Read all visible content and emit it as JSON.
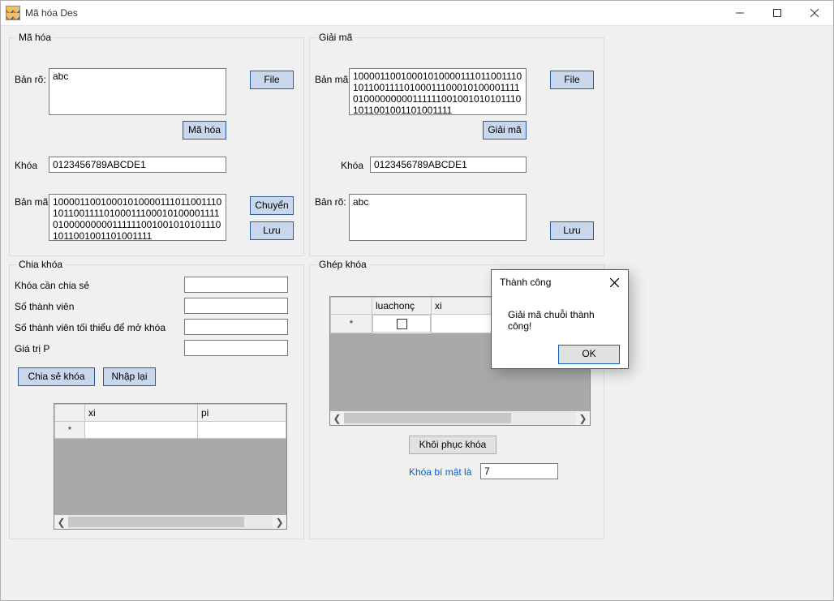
{
  "window": {
    "title": "Mã hóa Des"
  },
  "encrypt": {
    "legend": "Mã hóa",
    "plaintext_label": "Bản rõ:",
    "plaintext_value": "abc",
    "file_label": "File",
    "encrypt_btn": "Mã hóa",
    "key_label": "Khóa",
    "key_value": "0123456789ABCDE1",
    "ciphertext_label": "Bản mã:",
    "ciphertext_value": "1000011001000101000011101100111010110011110100011100010100001111010000000001111110010010101011101011001001101001111",
    "transfer_btn": "Chuyển",
    "save_btn": "Lưu"
  },
  "decrypt": {
    "legend": "Giải mã",
    "ciphertext_label": "Bản mã:",
    "ciphertext_value": "1000011001000101000011101100111010110011110100011100010100001111010000000001111110010010101011101011001001101001111",
    "file_label": "File",
    "decrypt_btn": "Giải mã",
    "key_label": "Khóa",
    "key_value": "0123456789ABCDE1",
    "plaintext_label": "Bản rõ:",
    "plaintext_value": "abc",
    "save_btn": "Lưu"
  },
  "split_key": {
    "legend": "Chia khóa",
    "key_to_share_label": "Khóa cần chia sẻ",
    "members_label": "Số thành viên",
    "min_members_label": "Số thành viên tối thiểu để mở khóa",
    "p_label": "Giá trị P",
    "share_btn": "Chia sẻ khóa",
    "reset_btn": "Nhập lại",
    "grid_cols": {
      "xi": "xi",
      "pi": "pi"
    }
  },
  "merge_key": {
    "legend": "Ghép khóa",
    "grid_cols": {
      "luachong": "luachonç",
      "xi": "xi"
    },
    "restore_btn": "Khôi phục khóa",
    "secret_label": "Khóa bí mật là",
    "secret_value": "7"
  },
  "dialog": {
    "title": "Thành công",
    "message": "Giải mã chuỗi thành công!",
    "ok": "OK"
  }
}
